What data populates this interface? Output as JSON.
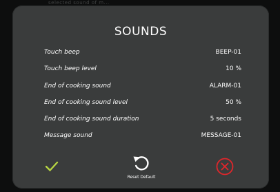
{
  "background": {
    "ghost_text": "selected sound of m..."
  },
  "dialog": {
    "title": "SOUNDS",
    "settings": [
      {
        "label": "Touch beep",
        "value": "BEEP-01"
      },
      {
        "label": "Touch beep level",
        "value": "10 %"
      },
      {
        "label": "End of cooking sound",
        "value": "ALARM-01"
      },
      {
        "label": "End of cooking sound level",
        "value": "50 %"
      },
      {
        "label": "End of cooking sound duration",
        "value": "5 seconds"
      },
      {
        "label": "Message sound",
        "value": "MESSAGE-01"
      }
    ],
    "actions": {
      "confirm_icon": "check-icon",
      "reset_icon": "reset-icon",
      "reset_label": "Reset Default",
      "cancel_icon": "close-circle-icon"
    }
  },
  "colors": {
    "dialog_bg": "#3a3c3c",
    "screen_bg": "#0d0e0e",
    "text": "#ffffff",
    "confirm": "#b6d442",
    "cancel": "#e0262b"
  }
}
